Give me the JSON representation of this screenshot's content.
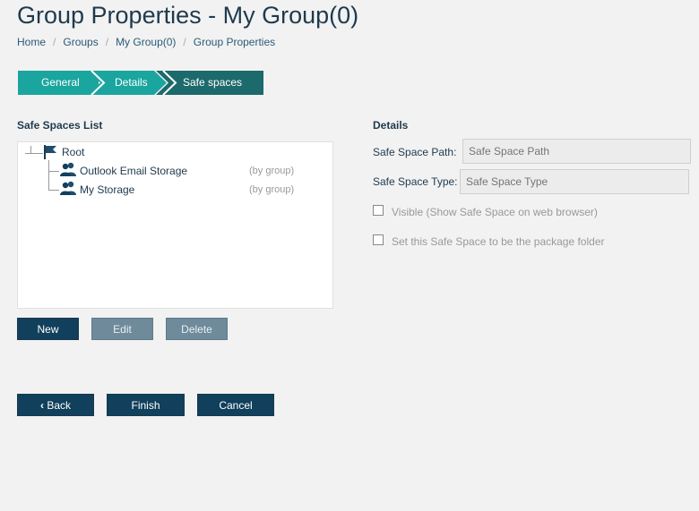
{
  "page": {
    "title": "Group Properties - My Group(0)"
  },
  "breadcrumb": [
    "Home",
    "Groups",
    "My Group(0)",
    "Group Properties"
  ],
  "wizard": {
    "steps": [
      "General",
      "Details",
      "Safe spaces"
    ],
    "active": "Safe spaces"
  },
  "safe_spaces": {
    "heading": "Safe Spaces List",
    "root": "Root",
    "items": [
      {
        "label": "Outlook Email Storage",
        "note": "(by group)"
      },
      {
        "label": "My Storage",
        "note": "(by group)"
      }
    ],
    "buttons": {
      "new": "New",
      "edit": "Edit",
      "delete": "Delete"
    }
  },
  "details": {
    "heading": "Details",
    "path_label": "Safe Space Path:",
    "path_placeholder": "Safe Space Path",
    "type_label": "Safe Space Type:",
    "type_placeholder": "Safe Space Type",
    "visible_label": "Visible (Show Safe Space on web browser)",
    "package_label": "Set this Safe Space to be the package folder"
  },
  "footer": {
    "back": "Back",
    "finish": "Finish",
    "cancel": "Cancel"
  },
  "colors": {
    "step_inactive": "#1aa59f",
    "step_active": "#1d6a6c",
    "primary_button": "#10405c",
    "disabled_button": "#6f8b9b"
  }
}
